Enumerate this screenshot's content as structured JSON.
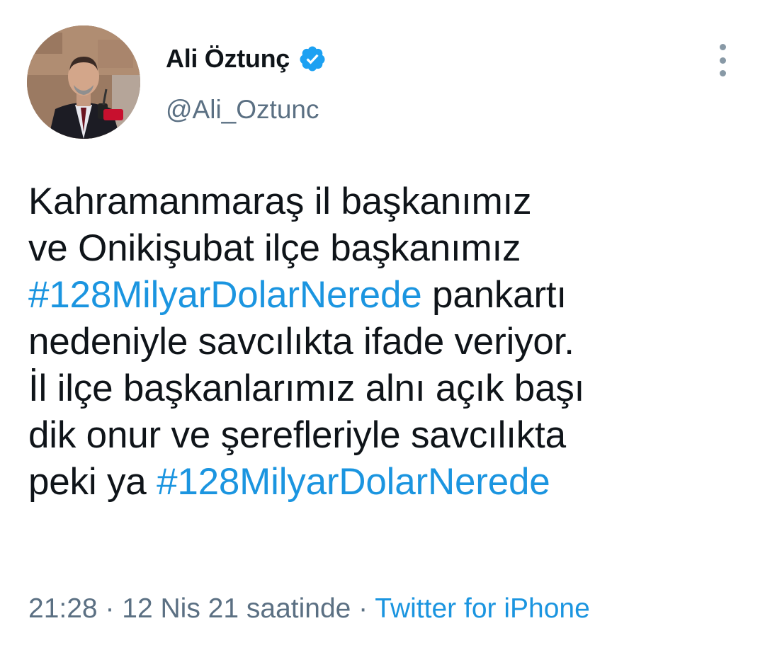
{
  "author": {
    "display_name": "Ali Öztunç",
    "handle": "@Ali_Oztunc",
    "verified": true
  },
  "tweet": {
    "lines": [
      [
        {
          "text": "Kahramanmaraş il başkanımız",
          "hashtag": false
        }
      ],
      [
        {
          "text": "ve Onikişubat ilçe başkanımız",
          "hashtag": false
        }
      ],
      [
        {
          "text": "#128MilyarDolarNerede",
          "hashtag": true
        },
        {
          "text": " pankartı",
          "hashtag": false
        }
      ],
      [
        {
          "text": "nedeniyle savcılıkta ifade veriyor.",
          "hashtag": false
        }
      ],
      [
        {
          "text": "İl ilçe başkanlarımız alnı açık başı",
          "hashtag": false
        }
      ],
      [
        {
          "text": "dik onur ve şerefleriyle savcılıkta",
          "hashtag": false
        }
      ],
      [
        {
          "text": "peki ya ",
          "hashtag": false
        },
        {
          "text": "#128MilyarDolarNerede",
          "hashtag": true
        }
      ]
    ]
  },
  "meta": {
    "time": "21:28",
    "separator": " · ",
    "date": "12 Nis 21 saatinde",
    "source": "Twitter for iPhone"
  },
  "icons": {
    "verified": "verified-badge-icon",
    "more": "more-vertical-icon"
  },
  "colors": {
    "link": "#1b95e0",
    "secondary_text": "#5b7083",
    "primary_text": "#0f1419",
    "verified": "#1da1f2"
  }
}
